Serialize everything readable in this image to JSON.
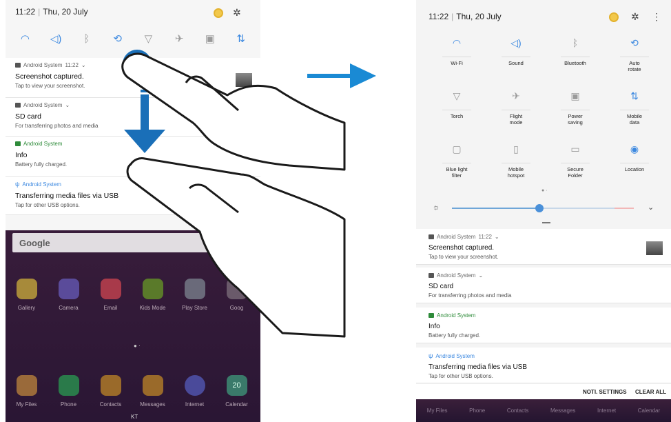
{
  "left": {
    "status": {
      "time": "11:22",
      "date": "Thu, 20 July"
    },
    "quick_icons": [
      "wifi-icon",
      "sound-icon",
      "bluetooth-icon",
      "auto-rotate-icon",
      "torch-icon",
      "flight-mode-icon",
      "power-saving-icon",
      "mobile-data-icon"
    ],
    "notifications": [
      {
        "source": "Android System",
        "time": "11:22",
        "title": "Screenshot captured.",
        "body": "Tap to view your screenshot."
      },
      {
        "source": "Android System",
        "title": "SD card",
        "body": "For transferring photos and media"
      },
      {
        "source": "Android System",
        "title": "Info",
        "body": "Battery fully charged."
      },
      {
        "source": "Android System",
        "title": "Transferring media files via USB",
        "body": "Tap for other USB options."
      }
    ],
    "search_label": "Google",
    "apps_row1": [
      "Gallery",
      "Camera",
      "Email",
      "Kids Mode",
      "Play Store",
      "Goog"
    ],
    "apps_row2": [
      "My Files",
      "Phone",
      "Contacts",
      "Messages",
      "Internet",
      "Calendar"
    ],
    "calendar_day": "20",
    "carrier": "KT"
  },
  "right": {
    "status": {
      "time": "11:22",
      "date": "Thu, 20 July"
    },
    "tiles": [
      {
        "label": "Wi-Fi",
        "icon": "wifi-icon",
        "on": true
      },
      {
        "label": "Sound",
        "icon": "sound-icon",
        "on": true
      },
      {
        "label": "Bluetooth",
        "icon": "bluetooth-icon",
        "on": false
      },
      {
        "label": "Auto rotate",
        "icon": "auto-rotate-icon",
        "on": true
      },
      {
        "label": "Torch",
        "icon": "torch-icon",
        "on": false
      },
      {
        "label": "Flight mode",
        "icon": "flight-mode-icon",
        "on": false
      },
      {
        "label": "Power saving",
        "icon": "power-saving-icon",
        "on": false
      },
      {
        "label": "Mobile data",
        "icon": "mobile-data-icon",
        "on": true
      },
      {
        "label": "Blue light filter",
        "icon": "blue-light-filter-icon",
        "on": false
      },
      {
        "label": "Mobile hotspot",
        "icon": "mobile-hotspot-icon",
        "on": false
      },
      {
        "label": "Secure Folder",
        "icon": "secure-folder-icon",
        "on": false
      },
      {
        "label": "Location",
        "icon": "location-icon",
        "on": true
      }
    ],
    "brightness": 0.48,
    "notifications": [
      {
        "source": "Android System",
        "time": "11:22",
        "title": "Screenshot captured.",
        "body": "Tap to view your screenshot."
      },
      {
        "source": "Android System",
        "title": "SD card",
        "body": "For transferring photos and media"
      },
      {
        "source": "Android System",
        "title": "Info",
        "body": "Battery fully charged."
      },
      {
        "source": "Android System",
        "title": "Transferring media files via USB",
        "body": "Tap for other USB options."
      }
    ],
    "footer": {
      "noti_settings": "NOTI. SETTINGS",
      "clear_all": "CLEAR ALL"
    },
    "dock": [
      "My Files",
      "Phone",
      "Contacts",
      "Messages",
      "Internet",
      "Calendar"
    ]
  },
  "colors": {
    "accent": "#3b88e0",
    "gesture_blue": "#1a6fb8",
    "green": "#2e8b3a"
  }
}
